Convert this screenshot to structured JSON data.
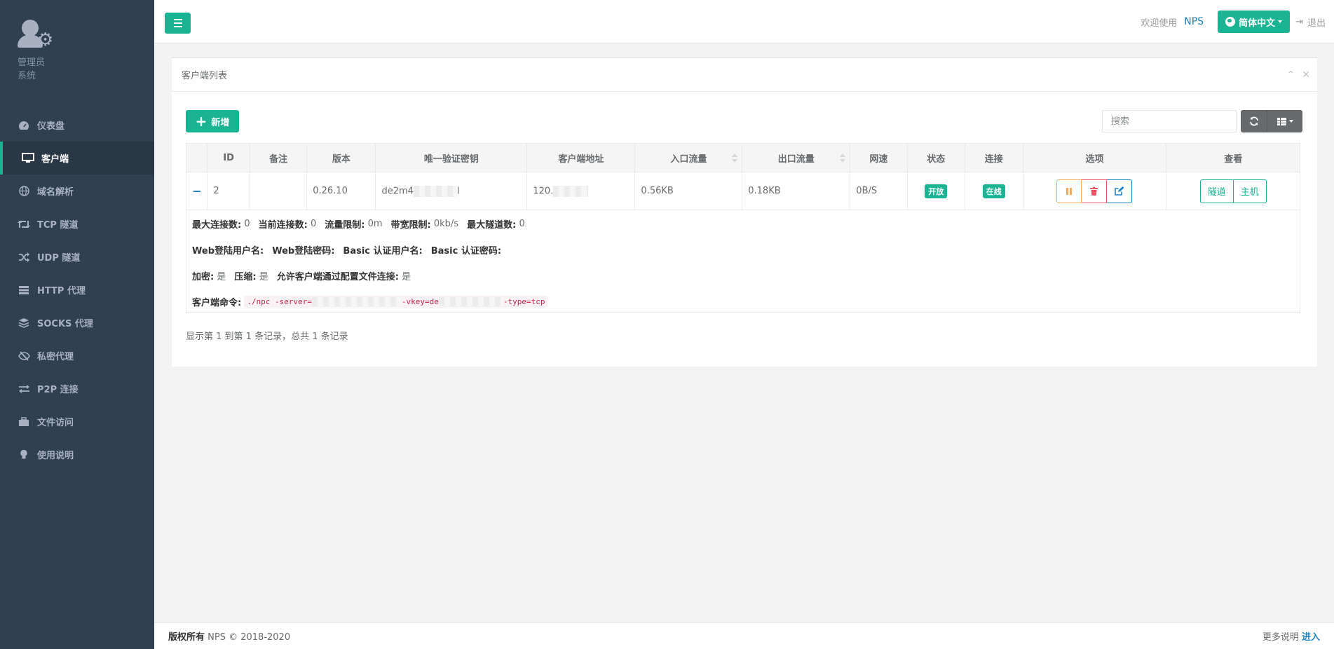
{
  "sidebar": {
    "profile": {
      "role": "管理员",
      "system": "系统"
    },
    "items": [
      {
        "label": "仪表盘",
        "icon": "dashboard-icon",
        "active": false
      },
      {
        "label": "客户端",
        "icon": "desktop-icon",
        "active": true
      },
      {
        "label": "域名解析",
        "icon": "globe-icon",
        "active": false
      },
      {
        "label": "TCP 隧道",
        "icon": "retweet-icon",
        "active": false
      },
      {
        "label": "UDP 隧道",
        "icon": "random-icon",
        "active": false
      },
      {
        "label": "HTTP 代理",
        "icon": "server-icon",
        "active": false
      },
      {
        "label": "SOCKS 代理",
        "icon": "layers-icon",
        "active": false
      },
      {
        "label": "私密代理",
        "icon": "eye-slash-icon",
        "active": false
      },
      {
        "label": "P2P 连接",
        "icon": "exchange-icon",
        "active": false
      },
      {
        "label": "文件访问",
        "icon": "briefcase-icon",
        "active": false
      },
      {
        "label": "使用说明",
        "icon": "lightbulb-icon",
        "active": false
      }
    ]
  },
  "topbar": {
    "welcome": "欢迎使用",
    "brand": "NPS",
    "language": "简体中文",
    "logout": "退出"
  },
  "panel": {
    "title": "客户端列表",
    "add_label": "新增",
    "search_placeholder": "搜索"
  },
  "table": {
    "headers": [
      "",
      "ID",
      "备注",
      "版本",
      "唯一验证密钥",
      "客户端地址",
      "入口流量",
      "出口流量",
      "网速",
      "状态",
      "连接",
      "选项",
      "查看"
    ],
    "row": {
      "id": "2",
      "remark": "",
      "version": "0.26.10",
      "vkey_visible": "de2m4",
      "vkey_tail": "l",
      "address_visible": "120.",
      "inflow": "0.56KB",
      "outflow": "0.18KB",
      "speed": "0B/S",
      "status": "开放",
      "connection": "在线",
      "view_tunnel": "隧道",
      "view_host": "主机"
    }
  },
  "detail": {
    "max_conn_label": "最大连接数:",
    "max_conn": "0",
    "cur_conn_label": "当前连接数:",
    "cur_conn": "0",
    "flow_limit_label": "流量限制:",
    "flow_limit": "0m",
    "rate_limit_label": "带宽限制:",
    "rate_limit": "0kb/s",
    "max_tunnel_label": "最大隧道数:",
    "max_tunnel": "0",
    "web_user_label": "Web登陆用户名:",
    "web_pass_label": "Web登陆密码:",
    "basic_user_label": "Basic 认证用户名:",
    "basic_pass_label": "Basic 认证密码:",
    "crypt_label": "加密:",
    "crypt": "是",
    "compress_label": "压缩:",
    "compress": "是",
    "config_conn_label": "允许客户端通过配置文件连接:",
    "config_conn": "是",
    "cmd_label": "客户端命令:",
    "cmd_part1": "./npc -server=",
    "cmd_part2": " -vkey=de",
    "cmd_part3": " -type=tcp"
  },
  "pager": {
    "info": "显示第 1 到第 1 条记录，总共 1 条记录"
  },
  "footer": {
    "copyright_bold": "版权所有",
    "copyright": " NPS © 2018-2020",
    "more": "更多说明",
    "enter": "进入"
  },
  "colors": {
    "primary": "#1ab394",
    "sidebar": "#2f4050",
    "link": "#1c84c6",
    "danger": "#ed5565",
    "warning": "#f8ac59"
  }
}
